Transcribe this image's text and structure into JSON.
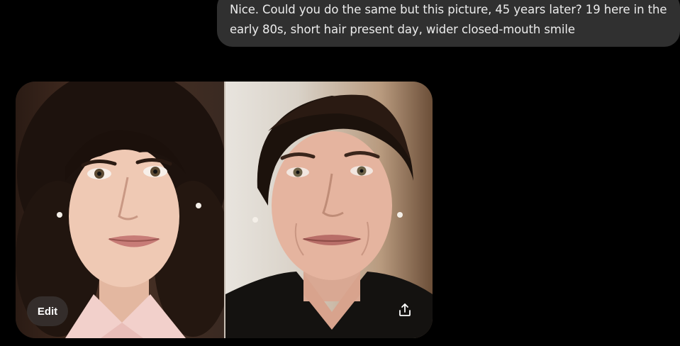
{
  "message": {
    "text": "Nice. Could you do the same but this picture, 45 years later? 19 here in the early 80s, short hair present day, wider closed-mouth smile"
  },
  "image_card": {
    "edit_label": "Edit",
    "share_icon": "share-upload-icon"
  },
  "colors": {
    "background": "#000000",
    "bubble": "#303030",
    "text": "#ececec"
  }
}
